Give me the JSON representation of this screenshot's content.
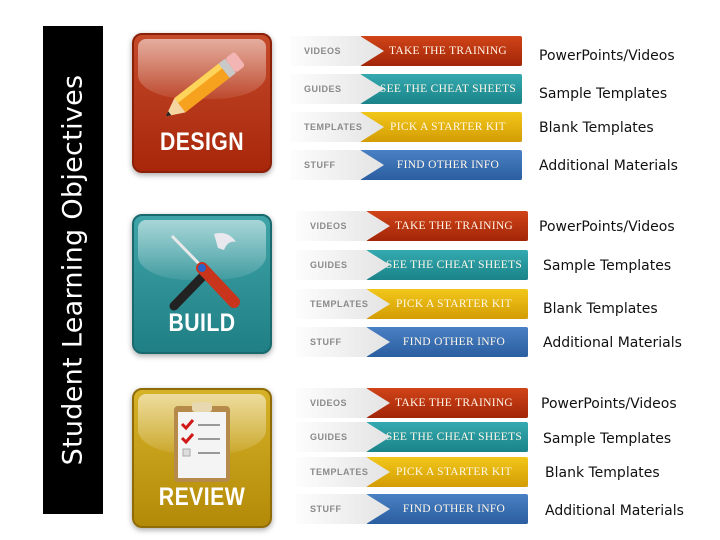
{
  "title": "Student Learning Objectives",
  "sections": [
    {
      "tile_label": "DESIGN",
      "icon": "pencil-icon",
      "rows": [
        {
          "tag": "VIDEOS",
          "action": "TAKE THE TRAINING",
          "color": "#b8320f",
          "description": "PowerPoints/Videos"
        },
        {
          "tag": "GUIDES",
          "action": "SEE THE CHEAT SHEETS",
          "color": "#26979d",
          "description": "Sample Templates"
        },
        {
          "tag": "TEMPLATES",
          "action": "PICK A STARTER KIT",
          "color": "#e2b010",
          "description": "Blank Templates"
        },
        {
          "tag": "STUFF",
          "action": "FIND OTHER INFO",
          "color": "#3a6fb2",
          "description": "Additional Materials"
        }
      ]
    },
    {
      "tile_label": "BUILD",
      "icon": "tools-icon",
      "rows": [
        {
          "tag": "VIDEOS",
          "action": "TAKE THE TRAINING",
          "color": "#b8320f",
          "description": "PowerPoints/Videos"
        },
        {
          "tag": "GUIDES",
          "action": "SEE THE CHEAT SHEETS",
          "color": "#26979d",
          "description": "Sample Templates"
        },
        {
          "tag": "TEMPLATES",
          "action": "PICK A STARTER KIT",
          "color": "#e2b010",
          "description": "Blank Templates"
        },
        {
          "tag": "STUFF",
          "action": "FIND OTHER INFO",
          "color": "#3a6fb2",
          "description": "Additional Materials"
        }
      ]
    },
    {
      "tile_label": "REVIEW",
      "icon": "clipboard-checklist-icon",
      "rows": [
        {
          "tag": "VIDEOS",
          "action": "TAKE THE TRAINING",
          "color": "#b8320f",
          "description": "PowerPoints/Videos"
        },
        {
          "tag": "GUIDES",
          "action": "SEE THE CHEAT SHEETS",
          "color": "#26979d",
          "description": "Sample Templates"
        },
        {
          "tag": "TEMPLATES",
          "action": "PICK A STARTER KIT",
          "color": "#e2b010",
          "description": "Blank Templates"
        },
        {
          "tag": "STUFF",
          "action": "FIND OTHER INFO",
          "color": "#3a6fb2",
          "description": "Additional Materials"
        }
      ]
    }
  ]
}
